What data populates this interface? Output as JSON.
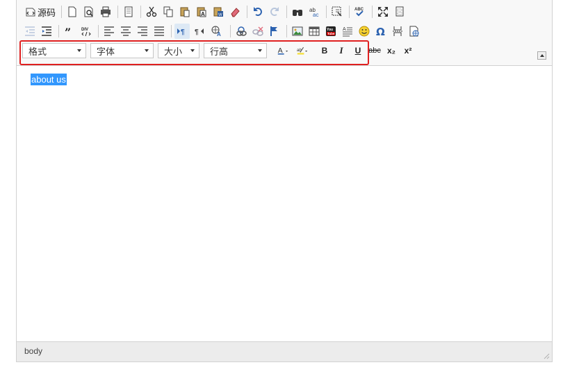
{
  "toolbar": {
    "source_label": "源码",
    "format_combo": "格式",
    "font_combo": "字体",
    "size_combo": "大小",
    "lineheight_combo": "行高",
    "bold_label": "B",
    "italic_label": "I",
    "underline_label": "U",
    "strike_label": "abc",
    "subscript_label": "x₂",
    "superscript_label": "x²"
  },
  "content": {
    "selected_text": "about us"
  },
  "statusbar": {
    "element_path": "body"
  },
  "colors": {
    "selection": "#3297fd",
    "highlight_border": "#e02020"
  }
}
